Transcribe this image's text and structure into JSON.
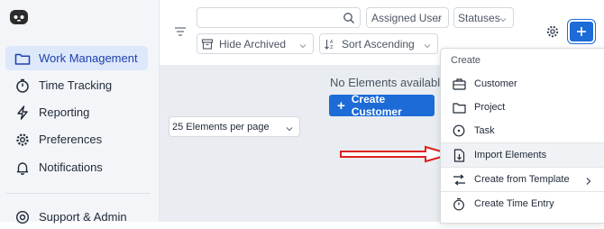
{
  "sidebar": {
    "items": [
      {
        "label": "Work Management",
        "icon": "folder-icon",
        "active": true
      },
      {
        "label": "Time Tracking",
        "icon": "stopwatch-icon"
      },
      {
        "label": "Reporting",
        "icon": "lightning-icon"
      },
      {
        "label": "Preferences",
        "icon": "gear-icon"
      },
      {
        "label": "Notifications",
        "icon": "bell-icon"
      },
      {
        "label": "Support & Admin",
        "icon": "help-icon"
      }
    ]
  },
  "toolbar": {
    "search_placeholder": "",
    "assigned_user": "Assigned User",
    "statuses": "Statuses",
    "hide_archived": "Hide Archived",
    "sort": "Sort Ascending"
  },
  "main": {
    "empty_text": "No Elements available",
    "create_customer": "Create Customer",
    "per_page": "25 Elements per page"
  },
  "menu": {
    "header": "Create",
    "items": [
      {
        "label": "Customer",
        "icon": "briefcase-icon"
      },
      {
        "label": "Project",
        "icon": "folder-icon"
      },
      {
        "label": "Task",
        "icon": "task-circle-icon"
      },
      {
        "label": "Import Elements",
        "icon": "import-file-icon",
        "highlight": true
      },
      {
        "label": "Create from Template",
        "icon": "template-icon",
        "submenu": true
      },
      {
        "label": "Create Time Entry",
        "icon": "stopwatch-icon"
      }
    ]
  },
  "colors": {
    "accent": "#1d6bd6",
    "annotation_arrow": "#e02020",
    "sidebar_active": "#dde8fb"
  }
}
